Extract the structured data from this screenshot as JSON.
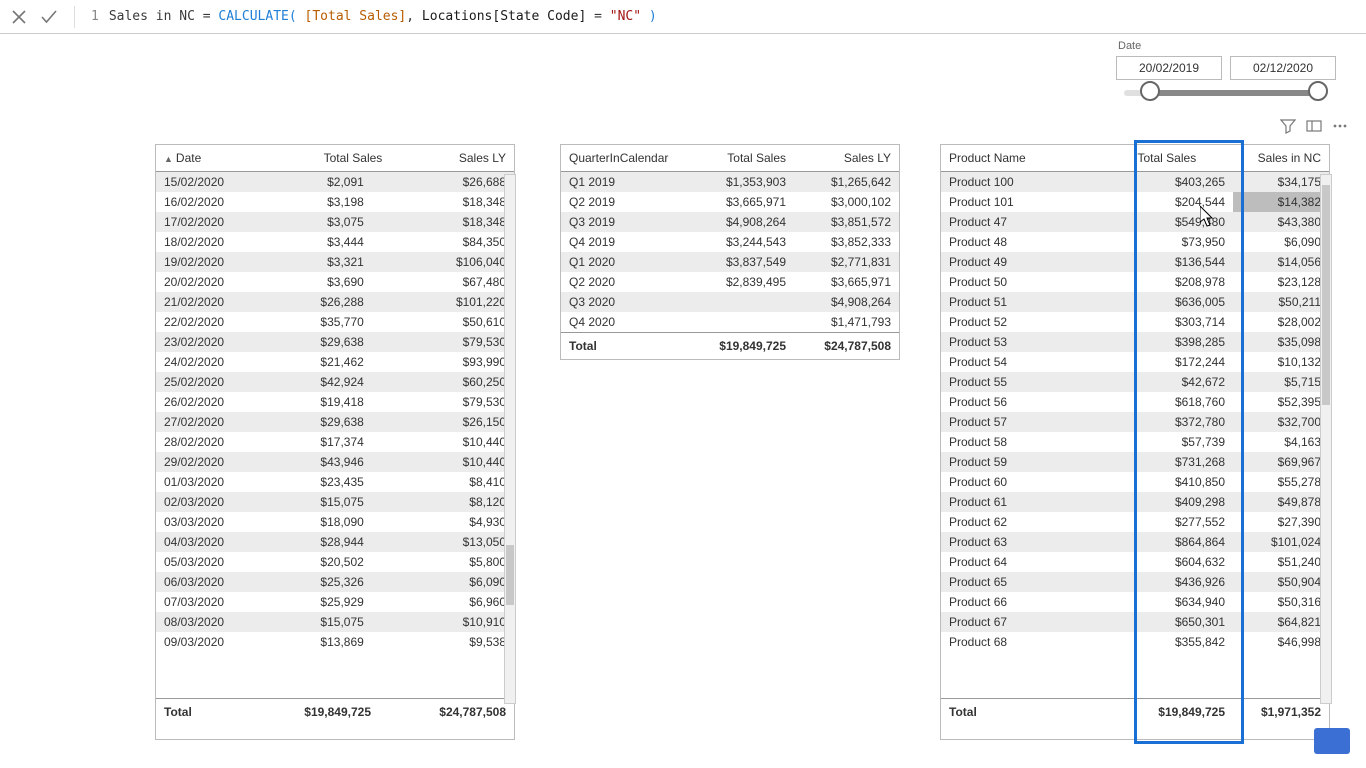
{
  "formula": {
    "line": "1",
    "seg_name": "Sales in NC ",
    "seg_eq": "= ",
    "seg_func": "CALCULATE",
    "seg_lparen": "(",
    "seg_space1": " ",
    "seg_measure": "[Total Sales]",
    "seg_comma": ", ",
    "seg_table": "Locations[State Code]",
    "seg_eq2": " = ",
    "seg_str": "\"NC\"",
    "seg_space2": " ",
    "seg_rparen": ")"
  },
  "date_slicer": {
    "label": "Date",
    "from": "20/02/2019",
    "to": "02/12/2020"
  },
  "daily": {
    "headers": {
      "c0": "Date",
      "c1": "Total Sales",
      "c2": "Sales LY"
    },
    "rows": [
      {
        "d": "15/02/2020",
        "ts": "$2,091",
        "ly": "$26,688"
      },
      {
        "d": "16/02/2020",
        "ts": "$3,198",
        "ly": "$18,348"
      },
      {
        "d": "17/02/2020",
        "ts": "$3,075",
        "ly": "$18,348"
      },
      {
        "d": "18/02/2020",
        "ts": "$3,444",
        "ly": "$84,350"
      },
      {
        "d": "19/02/2020",
        "ts": "$3,321",
        "ly": "$106,040"
      },
      {
        "d": "20/02/2020",
        "ts": "$3,690",
        "ly": "$67,480"
      },
      {
        "d": "21/02/2020",
        "ts": "$26,288",
        "ly": "$101,220"
      },
      {
        "d": "22/02/2020",
        "ts": "$35,770",
        "ly": "$50,610"
      },
      {
        "d": "23/02/2020",
        "ts": "$29,638",
        "ly": "$79,530"
      },
      {
        "d": "24/02/2020",
        "ts": "$21,462",
        "ly": "$93,990"
      },
      {
        "d": "25/02/2020",
        "ts": "$42,924",
        "ly": "$60,250"
      },
      {
        "d": "26/02/2020",
        "ts": "$19,418",
        "ly": "$79,530"
      },
      {
        "d": "27/02/2020",
        "ts": "$29,638",
        "ly": "$26,150"
      },
      {
        "d": "28/02/2020",
        "ts": "$17,374",
        "ly": "$10,440"
      },
      {
        "d": "29/02/2020",
        "ts": "$43,946",
        "ly": "$10,440"
      },
      {
        "d": "01/03/2020",
        "ts": "$23,435",
        "ly": "$8,410"
      },
      {
        "d": "02/03/2020",
        "ts": "$15,075",
        "ly": "$8,120"
      },
      {
        "d": "03/03/2020",
        "ts": "$18,090",
        "ly": "$4,930"
      },
      {
        "d": "04/03/2020",
        "ts": "$28,944",
        "ly": "$13,050"
      },
      {
        "d": "05/03/2020",
        "ts": "$20,502",
        "ly": "$5,800"
      },
      {
        "d": "06/03/2020",
        "ts": "$25,326",
        "ly": "$6,090"
      },
      {
        "d": "07/03/2020",
        "ts": "$25,929",
        "ly": "$6,960"
      },
      {
        "d": "08/03/2020",
        "ts": "$15,075",
        "ly": "$10,910"
      },
      {
        "d": "09/03/2020",
        "ts": "$13,869",
        "ly": "$9,538"
      }
    ],
    "total": {
      "label": "Total",
      "ts": "$19,849,725",
      "ly": "$24,787,508"
    }
  },
  "quarter": {
    "headers": {
      "c0": "QuarterInCalendar",
      "c1": "Total Sales",
      "c2": "Sales LY"
    },
    "rows": [
      {
        "q": "Q1 2019",
        "ts": "$1,353,903",
        "ly": "$1,265,642"
      },
      {
        "q": "Q2 2019",
        "ts": "$3,665,971",
        "ly": "$3,000,102"
      },
      {
        "q": "Q3 2019",
        "ts": "$4,908,264",
        "ly": "$3,851,572"
      },
      {
        "q": "Q4 2019",
        "ts": "$3,244,543",
        "ly": "$3,852,333"
      },
      {
        "q": "Q1 2020",
        "ts": "$3,837,549",
        "ly": "$2,771,831"
      },
      {
        "q": "Q2 2020",
        "ts": "$2,839,495",
        "ly": "$3,665,971"
      },
      {
        "q": "Q3 2020",
        "ts": "",
        "ly": "$4,908,264"
      },
      {
        "q": "Q4 2020",
        "ts": "",
        "ly": "$1,471,793"
      }
    ],
    "total": {
      "label": "Total",
      "ts": "$19,849,725",
      "ly": "$24,787,508"
    }
  },
  "product": {
    "headers": {
      "c0": "Product Name",
      "c1": "Total Sales",
      "c2": "Sales in NC"
    },
    "rows": [
      {
        "p": "Product 100",
        "ts": "$403,265",
        "nc": "$34,175"
      },
      {
        "p": "Product 101",
        "ts": "$204,544",
        "nc": "$14,382"
      },
      {
        "p": "Product 47",
        "ts": "$549,480",
        "nc": "$43,380"
      },
      {
        "p": "Product 48",
        "ts": "$73,950",
        "nc": "$6,090"
      },
      {
        "p": "Product 49",
        "ts": "$136,544",
        "nc": "$14,056"
      },
      {
        "p": "Product 50",
        "ts": "$208,978",
        "nc": "$23,128"
      },
      {
        "p": "Product 51",
        "ts": "$636,005",
        "nc": "$50,211"
      },
      {
        "p": "Product 52",
        "ts": "$303,714",
        "nc": "$28,002"
      },
      {
        "p": "Product 53",
        "ts": "$398,285",
        "nc": "$35,098"
      },
      {
        "p": "Product 54",
        "ts": "$172,244",
        "nc": "$10,132"
      },
      {
        "p": "Product 55",
        "ts": "$42,672",
        "nc": "$5,715"
      },
      {
        "p": "Product 56",
        "ts": "$618,760",
        "nc": "$52,395"
      },
      {
        "p": "Product 57",
        "ts": "$372,780",
        "nc": "$32,700"
      },
      {
        "p": "Product 58",
        "ts": "$57,739",
        "nc": "$4,163"
      },
      {
        "p": "Product 59",
        "ts": "$731,268",
        "nc": "$69,967"
      },
      {
        "p": "Product 60",
        "ts": "$410,850",
        "nc": "$55,278"
      },
      {
        "p": "Product 61",
        "ts": "$409,298",
        "nc": "$49,878"
      },
      {
        "p": "Product 62",
        "ts": "$277,552",
        "nc": "$27,390"
      },
      {
        "p": "Product 63",
        "ts": "$864,864",
        "nc": "$101,024"
      },
      {
        "p": "Product 64",
        "ts": "$604,632",
        "nc": "$51,240"
      },
      {
        "p": "Product 65",
        "ts": "$436,926",
        "nc": "$50,904"
      },
      {
        "p": "Product 66",
        "ts": "$634,940",
        "nc": "$50,316"
      },
      {
        "p": "Product 67",
        "ts": "$650,301",
        "nc": "$64,821"
      },
      {
        "p": "Product 68",
        "ts": "$355,842",
        "nc": "$46,998"
      }
    ],
    "total": {
      "label": "Total",
      "ts": "$19,849,725",
      "nc": "$1,971,352"
    }
  }
}
